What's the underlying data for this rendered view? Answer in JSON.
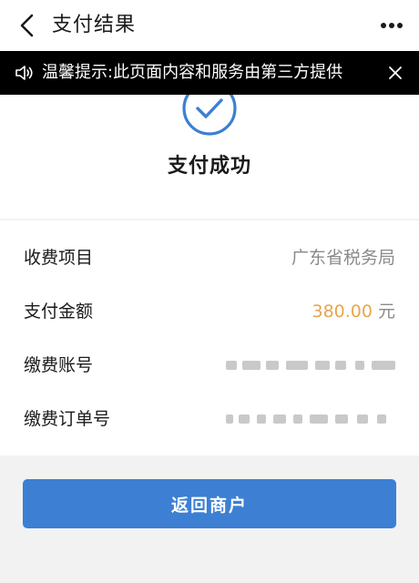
{
  "header": {
    "title": "支付结果",
    "back_icon": "chevron-left-icon",
    "more_icon": "more-dots-icon"
  },
  "notice": {
    "text": "温馨提示:此页面内容和服务由第三方提供",
    "speaker_icon": "speaker-icon",
    "close_icon": "close-icon"
  },
  "result": {
    "status_icon": "check-circle-icon",
    "status_text": "支付成功",
    "accent_color": "#3c7fd3"
  },
  "details": {
    "rows": [
      {
        "label": "收费项目",
        "value": "广东省税务局"
      },
      {
        "label": "支付金额",
        "amount": "380.00",
        "unit": "元"
      },
      {
        "label": "缴费账号"
      },
      {
        "label": "缴费订单号"
      }
    ],
    "amount_color": "#e8a64b"
  },
  "actions": {
    "return_label": "返回商户",
    "return_color": "#3c7fd3"
  }
}
